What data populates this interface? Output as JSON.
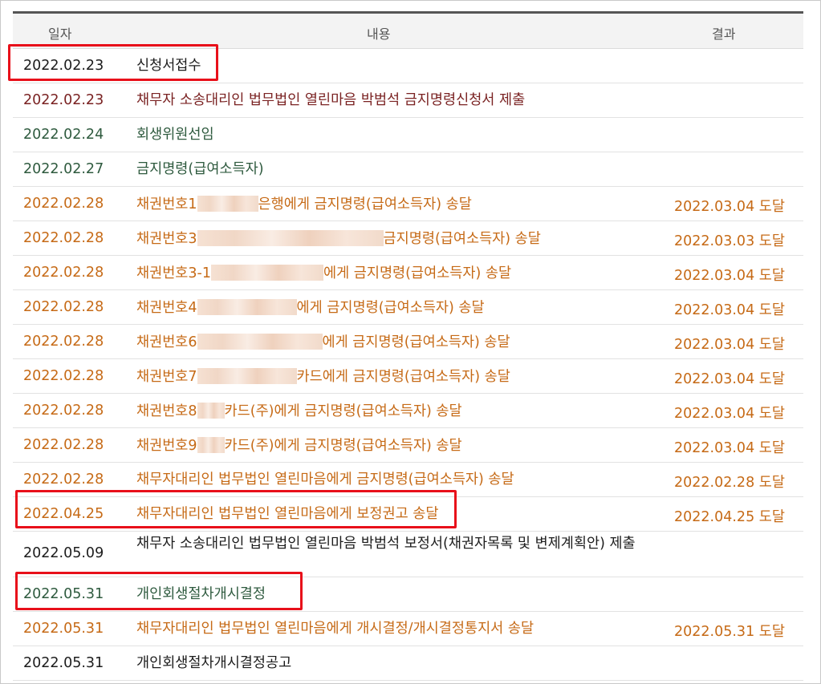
{
  "header": {
    "date": "일자",
    "content": "내용",
    "result": "결과"
  },
  "rows": [
    {
      "date": "2022.02.23",
      "content": "신청서접수",
      "result": "",
      "color": "#1c1c1c"
    },
    {
      "date": "2022.02.23",
      "content": "채무자 소송대리인 법무법인 열린마음 박범석 금지명령신청서 제출",
      "result": "",
      "color": "#7a2222"
    },
    {
      "date": "2022.02.24",
      "content": "회생위원선임",
      "result": "",
      "color": "#2e5a3e"
    },
    {
      "date": "2022.02.27",
      "content": "금지명령(급여소득자)",
      "result": "",
      "color": "#2e5a3e"
    },
    {
      "date": "2022.02.28",
      "content_pre": "채권번호1",
      "content_post": "은행에게 금지명령(급여소득자) 송달",
      "result": "2022.03.04 도달",
      "color": "#c66a16"
    },
    {
      "date": "2022.02.28",
      "content_pre": "채권번호3",
      "content_post": "금지명령(급여소득자) 송달",
      "result": "2022.03.03 도달",
      "color": "#c66a16"
    },
    {
      "date": "2022.02.28",
      "content_pre": "채권번호3-1",
      "content_post": "에게 금지명령(급여소득자) 송달",
      "result": "2022.03.04 도달",
      "color": "#c66a16"
    },
    {
      "date": "2022.02.28",
      "content_pre": "채권번호4",
      "content_post": "에게 금지명령(급여소득자) 송달",
      "result": "2022.03.04 도달",
      "color": "#c66a16"
    },
    {
      "date": "2022.02.28",
      "content_pre": "채권번호6",
      "content_post": "에게 금지명령(급여소득자) 송달",
      "result": "2022.03.04 도달",
      "color": "#c66a16"
    },
    {
      "date": "2022.02.28",
      "content_pre": "채권번호7",
      "content_post": "카드에게 금지명령(급여소득자) 송달",
      "result": "2022.03.04 도달",
      "color": "#c66a16"
    },
    {
      "date": "2022.02.28",
      "content_pre": "채권번호8",
      "content_post": "카드(주)에게 금지명령(급여소득자) 송달",
      "result": "2022.03.04 도달",
      "color": "#c66a16"
    },
    {
      "date": "2022.02.28",
      "content_pre": "채권번호9",
      "content_post": "카드(주)에게 금지명령(급여소득자) 송달",
      "result": "2022.03.04 도달",
      "color": "#c66a16"
    },
    {
      "date": "2022.02.28",
      "content": "채무자대리인 법무법인 열린마음에게 금지명령(급여소득자) 송달",
      "result": "2022.02.28 도달",
      "color": "#c66a16"
    },
    {
      "date": "2022.04.25",
      "content": "채무자대리인 법무법인 열린마음에게 보정권고 송달",
      "result": "2022.04.25 도달",
      "color": "#c66a16"
    },
    {
      "date": "2022.05.09",
      "content": "채무자 소송대리인 법무법인 열린마음 박범석 보정서(채권자목록 및 변제계획안) 제출",
      "result": "",
      "color": "#1c1c1c"
    },
    {
      "date": "2022.05.31",
      "content": "개인회생절차개시결정",
      "result": "",
      "color": "#2e5a3e"
    },
    {
      "date": "2022.05.31",
      "content": "채무자대리인 법무법인 열린마음에게 개시결정/개시결정통지서 송달",
      "result": "2022.05.31 도달",
      "color": "#c66a16"
    },
    {
      "date": "2022.05.31",
      "content": "개인회생절차개시결정공고",
      "result": "",
      "color": "#1c1c1c"
    }
  ],
  "colors": {
    "highlight": "#e8101a",
    "header_bg": "#f3f3f3",
    "top_rule": "#555555"
  }
}
